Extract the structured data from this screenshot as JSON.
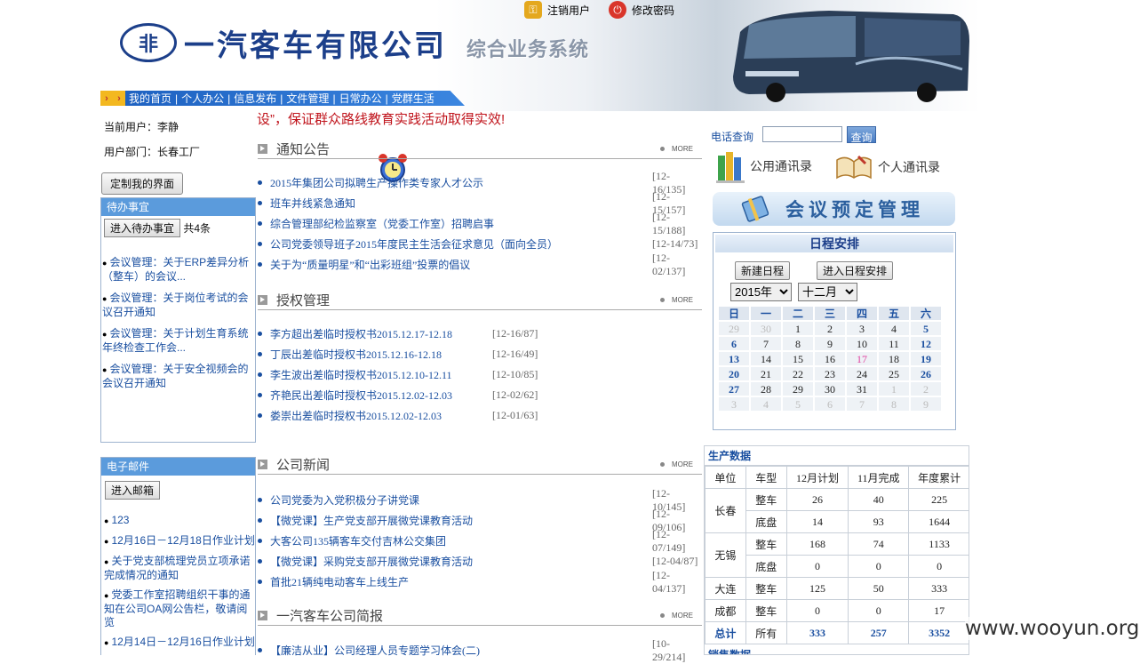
{
  "header": {
    "company": "一汽客车有限公司",
    "system": "综合业务系统",
    "logout": "注销用户",
    "change_password": "修改密码",
    "nav": [
      "我的首页",
      "个人办公",
      "信息发布",
      "文件管理",
      "日常办公",
      "党群生活"
    ]
  },
  "user": {
    "current_label": "当前用户：",
    "current_value": "李静",
    "dept_label": "用户部门：",
    "dept_value": "长春工厂",
    "customize": "定制我的界面"
  },
  "todo": {
    "title": "待办事宜",
    "enter": "进入待办事宜",
    "count": "共4条",
    "items": [
      "会议管理：关于ERP差异分析（整车）的会议...",
      "会议管理：关于岗位考试的会议召开通知",
      "会议管理：关于计划生育系统年终检查工作会...",
      "会议管理：关于安全视频会的会议召开通知"
    ]
  },
  "mail": {
    "title": "电子邮件",
    "enter": "进入邮箱",
    "items": [
      "123",
      "12月16日－12月18日作业计划",
      "关于党支部梳理党员立项承诺完成情况的通知",
      "党委工作室招聘组织干事的通知在公司OA网公告栏，敬请阅览",
      "12月14日－12月16日作业计划"
    ]
  },
  "marquee": "设”，保证群众路线教育实践活动取得实效!",
  "notice": {
    "title": "通知公告",
    "more": "MORE",
    "items": [
      {
        "t": "2015年集团公司拟聘生产操作类专家人才公示",
        "m": "[12-16/135]"
      },
      {
        "t": "班车并线紧急通知",
        "m": "[12-15/157]"
      },
      {
        "t": "综合管理部纪检监察室（党委工作室）招聘启事",
        "m": "[12-15/188]"
      },
      {
        "t": "公司党委领导班子2015年度民主生活会征求意见（面向全员）",
        "m": "[12-14/73]"
      },
      {
        "t": "关于为“质量明星”和“出彩班组”投票的倡议",
        "m": "[12-02/137]"
      }
    ]
  },
  "auth": {
    "title": "授权管理",
    "more": "MORE",
    "items": [
      {
        "t": "李方超出差临时授权书2015.12.17-12.18",
        "m": "[12-16/87]"
      },
      {
        "t": "丁辰出差临时授权书2015.12.16-12.18",
        "m": "[12-16/49]"
      },
      {
        "t": "李生波出差临时授权书2015.12.10-12.11",
        "m": "[12-10/85]"
      },
      {
        "t": "齐艳民出差临时授权书2015.12.02-12.03",
        "m": "[12-02/62]"
      },
      {
        "t": "娄崇出差临时授权书2015.12.02-12.03",
        "m": "[12-01/63]"
      }
    ]
  },
  "news": {
    "title": "公司新闻",
    "more": "MORE",
    "items": [
      {
        "t": "公司党委为入党积极分子讲党课",
        "m": "[12-10/145]"
      },
      {
        "t": "【微党课】生产党支部开展微党课教育活动",
        "m": "[12-09/106]"
      },
      {
        "t": "大客公司135辆客车交付吉林公交集团",
        "m": "[12-07/149]"
      },
      {
        "t": "【微党课】采购党支部开展微党课教育活动",
        "m": "[12-04/87]"
      },
      {
        "t": "首批21辆纯电动客车上线生产",
        "m": "[12-04/137]"
      }
    ]
  },
  "brief": {
    "title": "一汽客车公司简报",
    "more": "MORE",
    "items": [
      {
        "t": "【廉洁从业】公司经理人员专题学习体会(二)",
        "m": "[10-29/214]"
      }
    ]
  },
  "right": {
    "phone_label": "电话查询",
    "phone_value": "",
    "query": "查询",
    "public_book": "公用通讯录",
    "personal_book": "个人通讯录",
    "meeting": "会议预定管理",
    "schedule_title": "日程安排",
    "new_schedule": "新建日程",
    "enter_schedule": "进入日程安排",
    "year": "2015年",
    "month": "十二月",
    "weekdays": [
      "日",
      "一",
      "二",
      "三",
      "四",
      "五",
      "六"
    ],
    "days": [
      [
        "29",
        "30",
        "1",
        "2",
        "3",
        "4",
        "5"
      ],
      [
        "6",
        "7",
        "8",
        "9",
        "10",
        "11",
        "12"
      ],
      [
        "13",
        "14",
        "15",
        "16",
        "17",
        "18",
        "19"
      ],
      [
        "20",
        "21",
        "22",
        "23",
        "24",
        "25",
        "26"
      ],
      [
        "27",
        "28",
        "29",
        "30",
        "31",
        "1",
        "2"
      ],
      [
        "3",
        "4",
        "5",
        "6",
        "7",
        "8",
        "9"
      ]
    ]
  },
  "production": {
    "title": "生产数据",
    "headers": [
      "单位",
      "车型",
      "12月计划",
      "11月完成",
      "年度累计"
    ],
    "rows": [
      [
        "长春",
        "整车",
        "26",
        "40",
        "225"
      ],
      [
        "",
        "底盘",
        "14",
        "93",
        "1644"
      ],
      [
        "无锡",
        "整车",
        "168",
        "74",
        "1133"
      ],
      [
        "",
        "底盘",
        "0",
        "0",
        "0"
      ],
      [
        "大连",
        "整车",
        "125",
        "50",
        "333"
      ],
      [
        "成都",
        "整车",
        "0",
        "0",
        "17"
      ],
      [
        "总计",
        "所有",
        "333",
        "257",
        "3352"
      ]
    ],
    "next_title": "销售数据"
  },
  "watermark": "www.wooyun.org"
}
